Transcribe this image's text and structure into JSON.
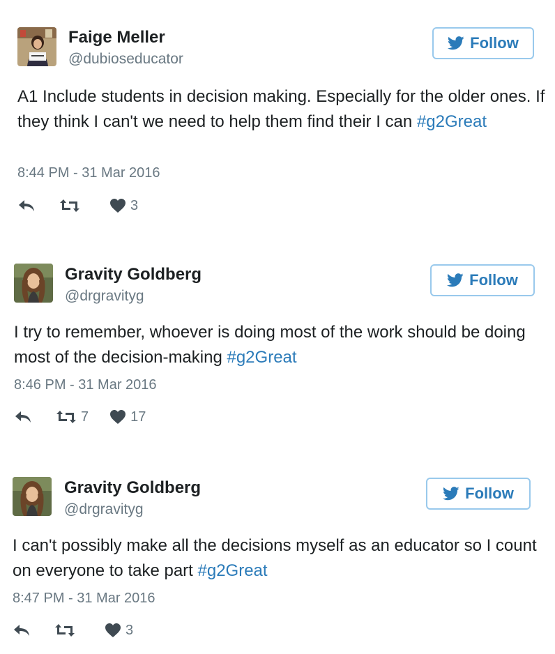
{
  "tweets": [
    {
      "author": {
        "name": "Faige Meller",
        "handle": "@dubioseducator",
        "avatar": "photo of woman holding a sign"
      },
      "follow_label": "Follow",
      "text": "A1 Include students in decision making. Especially for the older ones. If they think I can't we need to help them find their I can ",
      "hashtag": "#g2Great",
      "timestamp": "8:44 PM - 31 Mar 2016",
      "actions": {
        "reply": "reply-icon",
        "retweet": "retweet-icon",
        "like": "heart-icon"
      },
      "retweets": "",
      "likes": "3"
    },
    {
      "author": {
        "name": "Gravity Goldberg",
        "handle": "@drgravityg",
        "avatar": "photo of woman with curly hair"
      },
      "follow_label": "Follow",
      "text": "I try to remember, whoever is doing most of the work should be doing most of the decision-making ",
      "hashtag": "#g2Great",
      "timestamp": "8:46 PM - 31 Mar 2016",
      "actions": {
        "reply": "reply-icon",
        "retweet": "retweet-icon",
        "like": "heart-icon"
      },
      "retweets": "7",
      "likes": "17"
    },
    {
      "author": {
        "name": "Gravity Goldberg",
        "handle": "@drgravityg",
        "avatar": "photo of woman with curly hair"
      },
      "follow_label": "Follow",
      "text": "I can't possibly make all the decisions myself as an educator so I count on everyone to take part ",
      "hashtag": "#g2Great",
      "timestamp": "8:47 PM - 31 Mar 2016",
      "actions": {
        "reply": "reply-icon",
        "retweet": "retweet-icon",
        "like": "heart-icon"
      },
      "retweets": "",
      "likes": "3"
    }
  ],
  "colors": {
    "link": "#2b7bb9",
    "follow_border": "#99c9ec",
    "muted": "#697882",
    "icon": "#8899a6",
    "text": "#1c2022"
  }
}
